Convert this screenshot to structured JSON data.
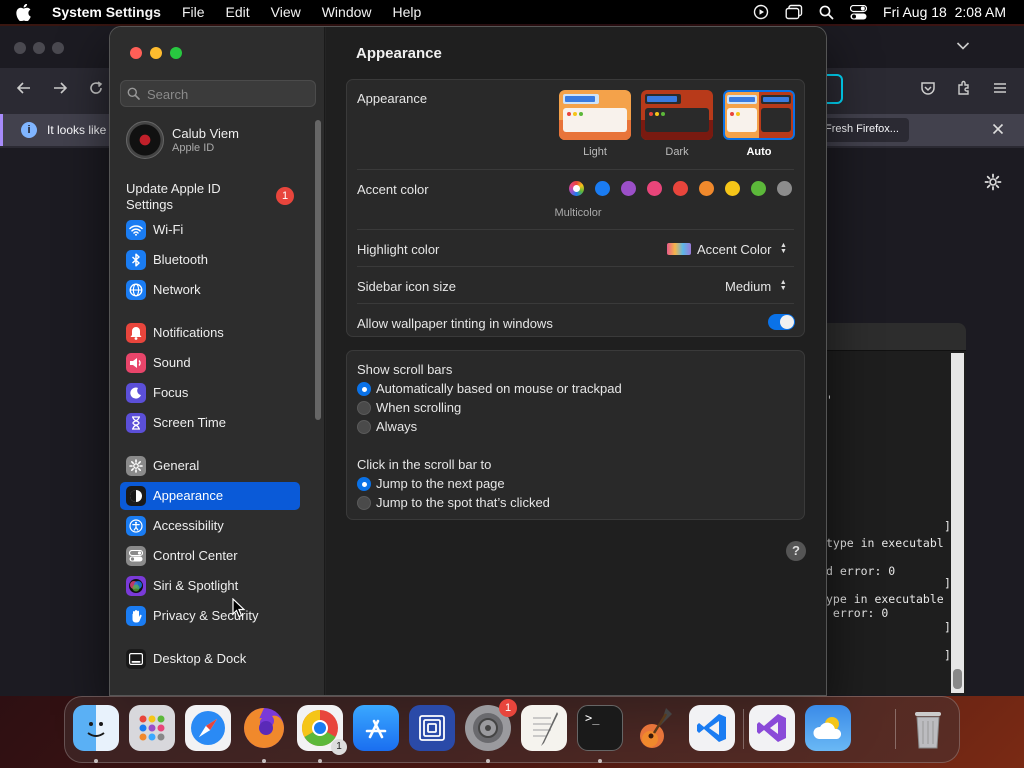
{
  "menubar": {
    "app_name": "System Settings",
    "menus": [
      "File",
      "Edit",
      "View",
      "Window",
      "Help"
    ],
    "datetime": "Fri Aug 18  2:08 AM"
  },
  "firefox": {
    "notification_text": "It looks like y",
    "refresh_button": "Fresh Firefox..."
  },
  "terminal": {
    "lines": [
      "'",
      "]",
      "type in executabl",
      "d error: 0",
      "]",
      "ype in executable",
      " error: 0",
      "]",
      "]"
    ]
  },
  "settings": {
    "search_placeholder": "Search",
    "account": {
      "name": "Calub Viem",
      "subtitle": "Apple ID"
    },
    "update": {
      "label": "Update Apple ID Settings",
      "badge": "1"
    },
    "sidebar_items": [
      {
        "label": "Wi-Fi",
        "icon": "wifi-icon",
        "color": "#1a7cf2"
      },
      {
        "label": "Bluetooth",
        "icon": "bluetooth-icon",
        "color": "#1a7cf2"
      },
      {
        "label": "Network",
        "icon": "globe-icon",
        "color": "#1a7cf2"
      },
      {
        "label": "Notifications",
        "icon": "bell-icon",
        "color": "#e8453c"
      },
      {
        "label": "Sound",
        "icon": "speaker-icon",
        "color": "#e8456a"
      },
      {
        "label": "Focus",
        "icon": "moon-icon",
        "color": "#5b4fd8"
      },
      {
        "label": "Screen Time",
        "icon": "hourglass-icon",
        "color": "#5b4fd8"
      },
      {
        "label": "General",
        "icon": "gear-icon",
        "color": "#8a8a8a"
      },
      {
        "label": "Appearance",
        "icon": "appearance-icon",
        "color": "#1a1a1a"
      },
      {
        "label": "Accessibility",
        "icon": "accessibility-icon",
        "color": "#1a7cf2"
      },
      {
        "label": "Control Center",
        "icon": "control-center-icon",
        "color": "#8a8a8a"
      },
      {
        "label": "Siri & Spotlight",
        "icon": "siri-icon",
        "color": "#7a3ad8"
      },
      {
        "label": "Privacy & Security",
        "icon": "hand-icon",
        "color": "#1a7cf2"
      },
      {
        "label": "Desktop & Dock",
        "icon": "dock-icon",
        "color": "#1a1a1a"
      }
    ],
    "active_item": "Appearance",
    "page_title": "Appearance",
    "appearance": {
      "label": "Appearance",
      "options": [
        "Light",
        "Dark",
        "Auto"
      ],
      "selected": "Auto"
    },
    "accent": {
      "label": "Accent color",
      "multicolor_label": "Multicolor",
      "colors": [
        "#1a7cf2",
        "#9b4fc8",
        "#e8457a",
        "#e8453c",
        "#f0892c",
        "#f5c518",
        "#5cb83a",
        "#8c8c8c"
      ]
    },
    "highlight": {
      "label": "Highlight color",
      "value": "Accent Color"
    },
    "sidebar_icon_size": {
      "label": "Sidebar icon size",
      "value": "Medium"
    },
    "wallpaper_tinting": {
      "label": "Allow wallpaper tinting in windows",
      "enabled": true
    },
    "scroll_bars": {
      "label": "Show scroll bars",
      "options": [
        "Automatically based on mouse or trackpad",
        "When scrolling",
        "Always"
      ],
      "selected": 0
    },
    "click_scroll": {
      "label": "Click in the scroll bar to",
      "options": [
        "Jump to the next page",
        "Jump to the spot that’s clicked"
      ],
      "selected": 0
    },
    "help": "?"
  },
  "dock": {
    "apps": [
      {
        "name": "Finder",
        "icon": "finder-icon"
      },
      {
        "name": "Launchpad",
        "icon": "launchpad-icon"
      },
      {
        "name": "Safari",
        "icon": "safari-icon"
      },
      {
        "name": "Firefox",
        "icon": "firefox-icon"
      },
      {
        "name": "Chrome",
        "icon": "chrome-icon",
        "badge2": "1"
      },
      {
        "name": "App Store",
        "icon": "app-store-icon"
      },
      {
        "name": "Screens",
        "icon": "screens-icon"
      },
      {
        "name": "System Settings",
        "icon": "system-settings-icon",
        "badge": "1"
      },
      {
        "name": "TextEdit",
        "icon": "textedit-icon"
      },
      {
        "name": "Terminal",
        "icon": "terminal-icon",
        "glyph": ">_"
      },
      {
        "name": "GarageBand",
        "icon": "guitar-icon"
      },
      {
        "name": "Visual Studio Code",
        "icon": "vscode-icon"
      },
      {
        "name": "Visual Studio",
        "icon": "visual-studio-icon"
      },
      {
        "name": "Weather",
        "icon": "weather-icon"
      },
      {
        "name": "Trash",
        "icon": "trash-icon"
      }
    ]
  }
}
